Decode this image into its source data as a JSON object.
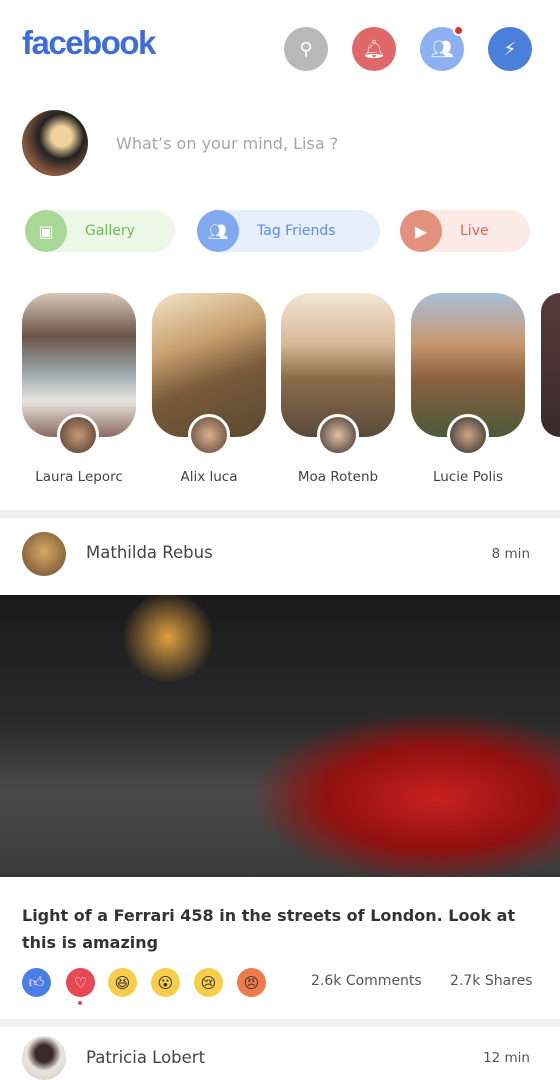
{
  "header": {
    "logo": "facebook",
    "icons": [
      "search-icon",
      "bell-icon",
      "friends-icon",
      "messenger-icon"
    ],
    "friends_badge": true
  },
  "composer": {
    "placeholder": "What’s on your mind, Lisa ?"
  },
  "actions": [
    {
      "label": "Gallery",
      "color": "#6dbb55",
      "icon": "gallery-icon"
    },
    {
      "label": "Tag Friends",
      "color": "#5b8be8",
      "icon": "friends-icon"
    },
    {
      "label": "Live",
      "color": "#e0684f",
      "icon": "video-icon"
    }
  ],
  "stories": [
    {
      "name": "Laura Leporc"
    },
    {
      "name": "Alix luca"
    },
    {
      "name": "Moa Rotenb"
    },
    {
      "name": "Lucie Polis"
    }
  ],
  "posts": [
    {
      "author": "Mathilda Rebus",
      "time": "8 min",
      "caption": "Light of a Ferrari 458 in the streets of London. Look at this is amazing",
      "reactions": [
        "like",
        "love",
        "haha",
        "wow",
        "sad",
        "angry"
      ],
      "selected_reaction": "love",
      "comments": "2.6k Comments",
      "shares": "2.7k Shares"
    },
    {
      "author": "Patricia Lobert",
      "time": "12 min"
    }
  ]
}
